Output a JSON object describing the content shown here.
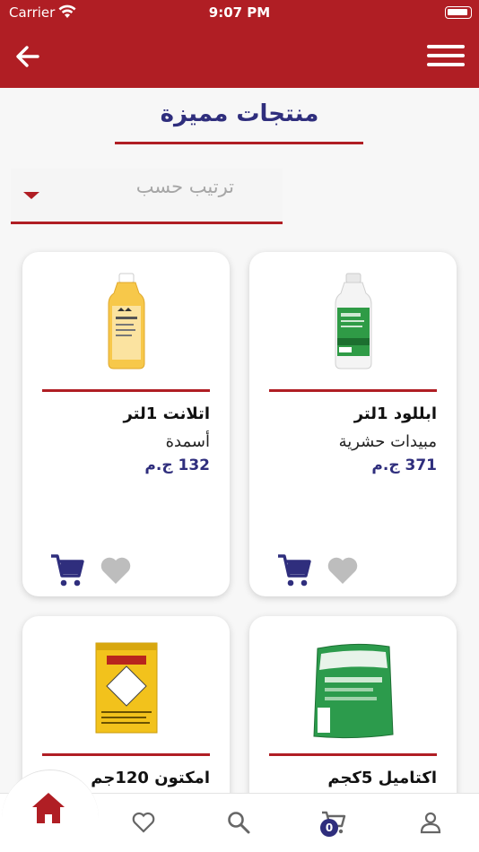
{
  "status": {
    "carrier": "Carrier",
    "time": "9:07 PM"
  },
  "header": {
    "title": "منتجات مميزة"
  },
  "sort": {
    "label": "ترتيب حسب"
  },
  "products": [
    {
      "name": "ابللود 1لتر",
      "category": "مبيدات حشرية",
      "price": "371 ج.م"
    },
    {
      "name": "اتلانت 1لتر",
      "category": "أسمدة",
      "price": "132 ج.م"
    },
    {
      "name": "اكتاميل 5كجم",
      "category": "",
      "price": ""
    },
    {
      "name": "امكتون 120جم",
      "category": "",
      "price": ""
    }
  ],
  "tabbar": {
    "cart_count": "0"
  },
  "colors": {
    "primary": "#b01e24",
    "accent": "#2f2e7d",
    "icon_gray": "#bdbdbd"
  },
  "icons": [
    "back-arrow-icon",
    "menu-icon",
    "cart-icon",
    "heart-icon",
    "home-icon",
    "search-icon",
    "user-icon"
  ]
}
